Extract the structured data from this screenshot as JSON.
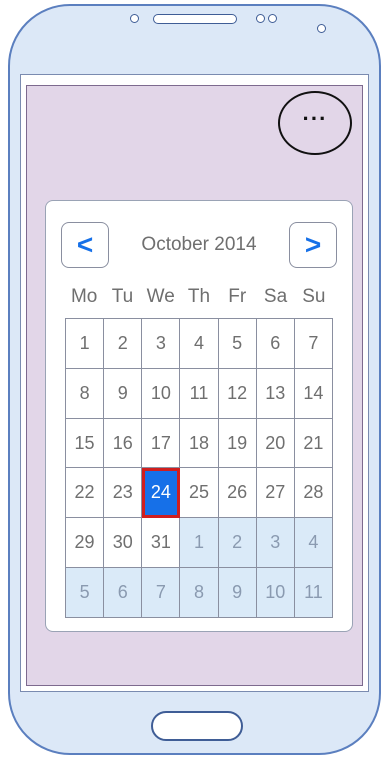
{
  "menu": {
    "label": "···"
  },
  "calendar": {
    "title": "October 2014",
    "prev_label": "<",
    "next_label": ">",
    "weekdays": [
      "Mo",
      "Tu",
      "We",
      "Th",
      "Fr",
      "Sa",
      "Su"
    ],
    "selected_day": "24",
    "days": [
      {
        "label": "1",
        "current": true
      },
      {
        "label": "2",
        "current": true
      },
      {
        "label": "3",
        "current": true
      },
      {
        "label": "4",
        "current": true
      },
      {
        "label": "5",
        "current": true
      },
      {
        "label": "6",
        "current": true
      },
      {
        "label": "7",
        "current": true
      },
      {
        "label": "8",
        "current": true
      },
      {
        "label": "9",
        "current": true
      },
      {
        "label": "10",
        "current": true
      },
      {
        "label": "11",
        "current": true
      },
      {
        "label": "12",
        "current": true
      },
      {
        "label": "13",
        "current": true
      },
      {
        "label": "14",
        "current": true
      },
      {
        "label": "15",
        "current": true
      },
      {
        "label": "16",
        "current": true
      },
      {
        "label": "17",
        "current": true
      },
      {
        "label": "18",
        "current": true
      },
      {
        "label": "19",
        "current": true
      },
      {
        "label": "20",
        "current": true
      },
      {
        "label": "21",
        "current": true
      },
      {
        "label": "22",
        "current": true
      },
      {
        "label": "23",
        "current": true
      },
      {
        "label": "24",
        "current": true
      },
      {
        "label": "25",
        "current": true
      },
      {
        "label": "26",
        "current": true
      },
      {
        "label": "27",
        "current": true
      },
      {
        "label": "28",
        "current": true
      },
      {
        "label": "29",
        "current": true
      },
      {
        "label": "30",
        "current": true
      },
      {
        "label": "31",
        "current": true
      },
      {
        "label": "1",
        "current": false
      },
      {
        "label": "2",
        "current": false
      },
      {
        "label": "3",
        "current": false
      },
      {
        "label": "4",
        "current": false
      },
      {
        "label": "5",
        "current": false
      },
      {
        "label": "6",
        "current": false
      },
      {
        "label": "7",
        "current": false
      },
      {
        "label": "8",
        "current": false
      },
      {
        "label": "9",
        "current": false
      },
      {
        "label": "10",
        "current": false
      },
      {
        "label": "11",
        "current": false
      }
    ]
  },
  "colors": {
    "accent": "#1670e8",
    "selected_border": "#d01e1e",
    "screen_background": "#e2d6e8",
    "device_body": "#dce8f7",
    "other_month_cell": "#daeaf8"
  }
}
